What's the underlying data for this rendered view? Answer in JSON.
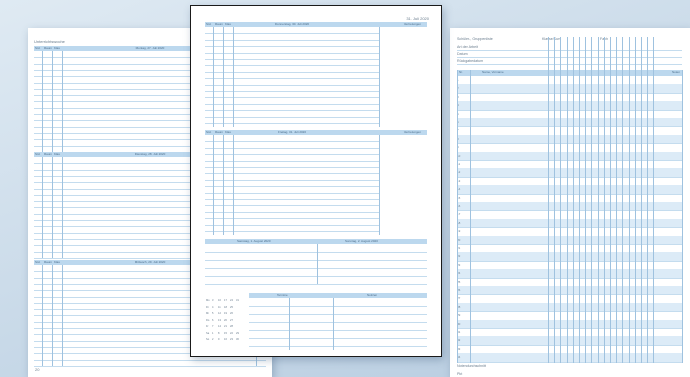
{
  "left_page": {
    "heading": "Unterrichtswoche",
    "columns": [
      "Std.",
      "Raum",
      "Klas"
    ],
    "days": [
      {
        "label": "Montag, 27. Juli 2020"
      },
      {
        "label": "Dienstag, 28. Juli 2020"
      },
      {
        "label": "Mittwoch, 29. Juli 2020"
      }
    ],
    "page_number": "20"
  },
  "middle_page": {
    "date": "31. Juli 2020",
    "columns": [
      "Std.",
      "Raum",
      "Klas"
    ],
    "days": [
      {
        "label": "Donnerstag, 30. Juli 2020",
        "side": "Vertretungen"
      },
      {
        "label": "Freitag, 31. Juli 2020",
        "side": "Vertretungen"
      }
    ],
    "weekend": [
      "Samstag, 1. August 2020",
      "Sonntag, 2. August 2020"
    ],
    "bottom_headers": [
      "Termine",
      "Notizen"
    ],
    "minical_rows": [
      [
        "Mo",
        "3",
        "10",
        "17",
        "24",
        "31"
      ],
      [
        "Di",
        "4",
        "11",
        "18",
        "25",
        ""
      ],
      [
        "Mi",
        "5",
        "12",
        "19",
        "26",
        ""
      ],
      [
        "Do",
        "6",
        "13",
        "20",
        "27",
        ""
      ],
      [
        "Fr",
        "7",
        "14",
        "21",
        "28",
        ""
      ],
      [
        "Sa",
        "1",
        "8",
        "15",
        "22",
        "29"
      ],
      [
        "So",
        "2",
        "9",
        "16",
        "23",
        "30"
      ]
    ]
  },
  "right_page": {
    "top_labels": [
      "Schüler-, Gruppenliste",
      "Klasse/Kurs",
      "Fach"
    ],
    "fields": [
      "Art der Arbeit",
      "Datum",
      "Rückgabedatum"
    ],
    "table_header": {
      "nr": "Nr.",
      "name": "Name, Vorname",
      "side": "Noten"
    },
    "rows": [
      "1",
      "2",
      "3",
      "4",
      "5",
      "6",
      "7",
      "8",
      "9",
      "10",
      "11",
      "12",
      "13",
      "14",
      "15",
      "16",
      "17",
      "18",
      "19",
      "20",
      "21",
      "22",
      "23",
      "24",
      "25",
      "26",
      "27",
      "28",
      "29",
      "30",
      "31",
      "32",
      "33",
      "34"
    ],
    "footer": "Notendurchschnitt",
    "footer_label": "Pkt"
  }
}
